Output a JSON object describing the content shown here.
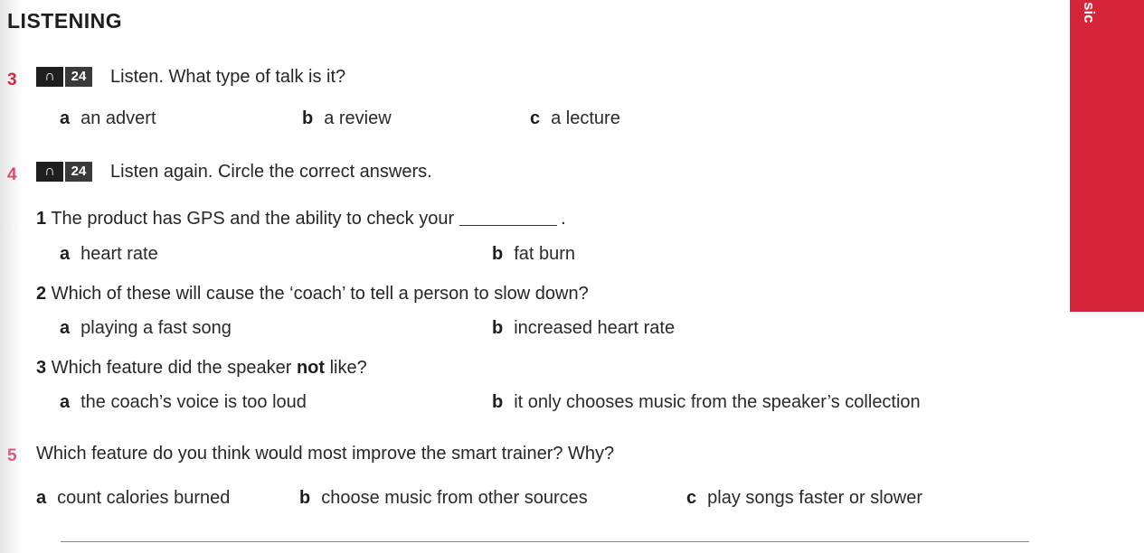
{
  "page": {
    "section_title": "LISTENING",
    "side_tab_text": "sic",
    "exercise3": {
      "number": "3",
      "track": "24",
      "instruction": "Listen. What type of talk is it?",
      "options": [
        {
          "label": "a",
          "text": "an advert"
        },
        {
          "label": "b",
          "text": "a review"
        },
        {
          "label": "c",
          "text": "a lecture"
        }
      ]
    },
    "exercise4": {
      "number": "4",
      "track": "24",
      "instruction": "Listen again. Circle the correct answers.",
      "questions": [
        {
          "num": "1",
          "text_before": "The product has GPS and the ability to check your",
          "text_after": ".",
          "options": [
            {
              "label": "a",
              "text": "heart rate"
            },
            {
              "label": "b",
              "text": "fat burn"
            }
          ]
        },
        {
          "num": "2",
          "text": "Which of these will cause the ‘coach’ to tell a person to slow down?",
          "options": [
            {
              "label": "a",
              "text": "playing a fast song"
            },
            {
              "label": "b",
              "text": "increased heart rate"
            }
          ]
        },
        {
          "num": "3",
          "text_before": "Which feature did the speaker",
          "emphasis": "not",
          "text_after": "like?",
          "options": [
            {
              "label": "a",
              "text": "the coach’s voice is too loud"
            },
            {
              "label": "b",
              "text": "it only chooses music from the speaker’s collection"
            }
          ]
        }
      ]
    },
    "exercise5": {
      "number": "5",
      "instruction": "Which feature do you think would most improve the smart trainer? Why?",
      "options": [
        {
          "label": "a",
          "text": "count calories burned"
        },
        {
          "label": "b",
          "text": "choose music from other sources"
        },
        {
          "label": "c",
          "text": "play songs faster or slower"
        }
      ]
    },
    "colors": {
      "exercise3_number": "#d6253b",
      "exercise4_number": "#d94a6a",
      "exercise5_number": "#e05a7a",
      "side_tab": "#d6253b"
    }
  }
}
